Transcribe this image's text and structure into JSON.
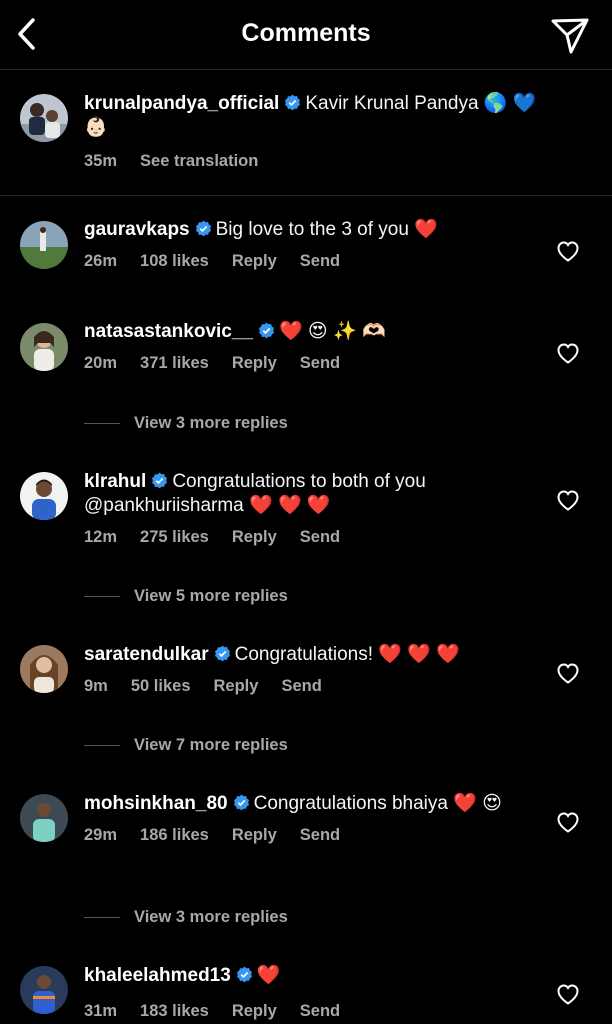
{
  "header": {
    "title": "Comments"
  },
  "caption": {
    "username": "krunalpandya_official",
    "text": "Kavir Krunal Pandya 🌎 💙 👶🏻",
    "time": "35m",
    "see_translation": "See translation"
  },
  "comments": [
    {
      "username": "gauravkaps",
      "text": "Big love to the 3 of you ❤️",
      "time": "26m",
      "likes": "108 likes",
      "reply": "Reply",
      "send": "Send"
    },
    {
      "username": "natasastankovic__",
      "text": "❤️ 😍 ✨ 🫶🏻",
      "time": "20m",
      "likes": "371 likes",
      "reply": "Reply",
      "send": "Send",
      "replies_label": "View 3 more replies"
    },
    {
      "username": "klrahul",
      "text": "Congratulations to both of you @pankhuriisharma ❤️ ❤️ ❤️",
      "time": "12m",
      "likes": "275 likes",
      "reply": "Reply",
      "send": "Send",
      "replies_label": "View 5 more replies"
    },
    {
      "username": "saratendulkar",
      "text": "Congratulations! ❤️ ❤️ ❤️",
      "time": "9m",
      "likes": "50 likes",
      "reply": "Reply",
      "send": "Send",
      "replies_label": "View 7 more replies"
    },
    {
      "username": "mohsinkhan_80",
      "text": "Congratulations bhaiya ❤️ 😍",
      "time": "29m",
      "likes": "186 likes",
      "reply": "Reply",
      "send": "Send",
      "replies_label": "View 3 more replies"
    },
    {
      "username": "khaleelahmed13",
      "text": "❤️",
      "time": "31m",
      "likes": "183 likes",
      "reply": "Reply",
      "send": "Send"
    }
  ],
  "icons": {
    "back": "chevron-left-icon",
    "send": "paper-plane-icon",
    "verified": "verified-badge-icon",
    "like": "heart-outline-icon"
  },
  "colors": {
    "background": "#000000",
    "text": "#f5f5f5",
    "secondary_text": "#a8a8a8",
    "verified": "#3897f0",
    "heart": "#ed2a36"
  }
}
